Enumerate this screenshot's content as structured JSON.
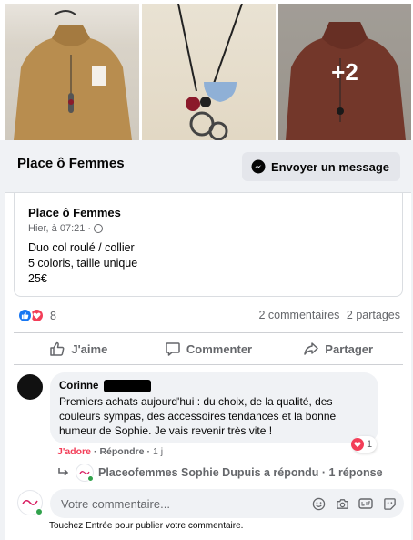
{
  "photos": {
    "more_count": "+2"
  },
  "page_header": {
    "name": "Place ô Femmes",
    "message_button": "Envoyer un message"
  },
  "post": {
    "author": "Place ô Femmes",
    "time": "Hier, à 07:21 ·",
    "lines": [
      "Duo col roulé / collier",
      "5 coloris, taille unique",
      "25€"
    ]
  },
  "reactions": {
    "count": "8",
    "comments": "2 commentaires",
    "shares": "2 partages"
  },
  "actions": {
    "like": "J'aime",
    "comment": "Commenter",
    "share": "Partager"
  },
  "comment": {
    "author": "Corinne",
    "text": "Premiers achats aujourd'hui : du choix, de la qualité, des couleurs sympas, des accessoires tendances et la bonne humeur de Sophie. Je vais revenir très vite !",
    "reaction_count": "1",
    "love_label": "J'adore",
    "reply_label": "Répondre",
    "separator": "·",
    "age": "1 j",
    "replied_text": "Placeofemmes Sophie Dupuis a répondu · 1 réponse"
  },
  "composer": {
    "placeholder": "Votre commentaire...",
    "hint": "Touchez Entrée pour publier votre commentaire."
  },
  "colors": {
    "accent": "#1877f2",
    "love": "#f33e58",
    "online": "#31a24c"
  }
}
